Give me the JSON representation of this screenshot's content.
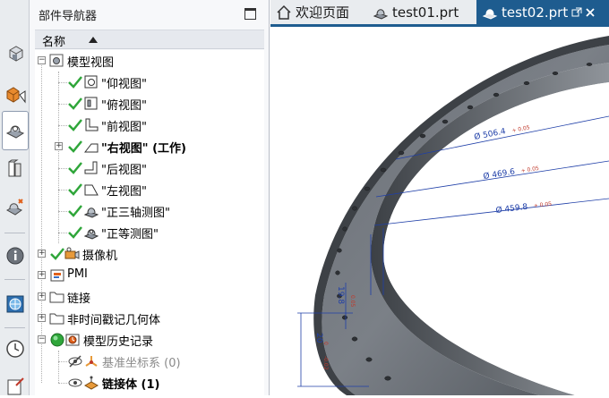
{
  "navigator": {
    "title": "部件导航器",
    "column_header": "名称",
    "tree": {
      "model_views": "模型视图",
      "views": [
        "\"仰视图\"",
        "\"俯视图\"",
        "\"前视图\"",
        "\"右视图\" (工作)",
        "\"后视图\"",
        "\"左视图\"",
        "\"正三轴测图\"",
        "\"正等测图\""
      ],
      "camera": "摄像机",
      "pmi": "PMI",
      "links": "链接",
      "non_timestamp": "非时间戳记几何体",
      "history": "模型历史记录",
      "datum_csys": "基准坐标系 (0)",
      "linked_body": "链接体 (1)"
    }
  },
  "tabs": {
    "welcome": "欢迎页面",
    "file1": "test01.prt",
    "file2": "test02.prt"
  },
  "viewport": {
    "dims": {
      "d1": "Ø 506.4",
      "d1_tol": "+ 0.05",
      "d2": "Ø 469.6",
      "d2_tol": "+ 0.05",
      "d3": "Ø 459.8",
      "d3_tol": "+ 0.05",
      "v1": "20",
      "v2": "0",
      "v3": "-0.02",
      "v4": "19.8",
      "v5": "0.05"
    }
  },
  "colors": {
    "tab_active": "#1e5c8f",
    "check": "#2fa63a",
    "dimension": "#1f3fa8"
  }
}
